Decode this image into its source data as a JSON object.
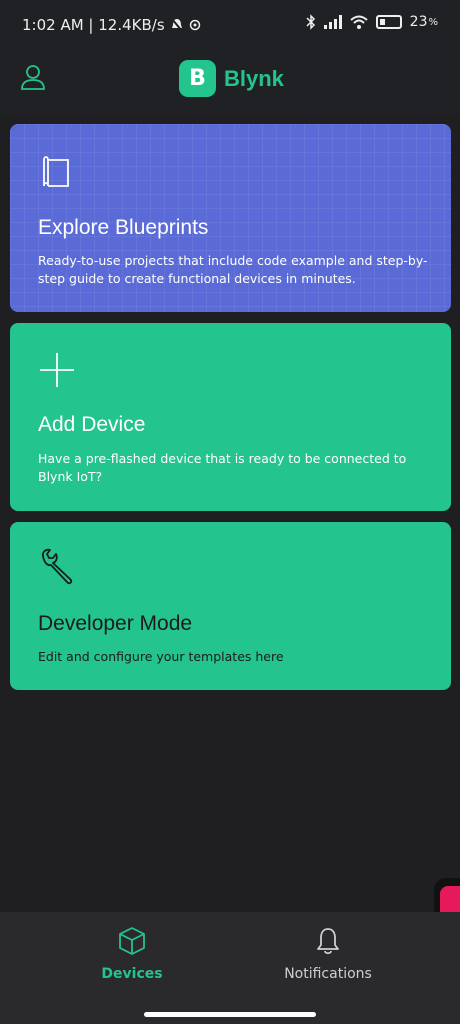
{
  "status_bar": {
    "time_speed": "1:02 AM | 12.4KB/s",
    "battery": "23"
  },
  "header": {
    "brand_letter": "B",
    "brand_name": "Blynk"
  },
  "cards": [
    {
      "title": "Explore Blueprints",
      "description": "Ready-to-use projects that include code example and step-by-step guide to create functional devices in minutes.",
      "icon": "book-icon"
    },
    {
      "title": "Add Device",
      "description": "Have a pre-flashed device that is ready to be connected to Blynk IoT?",
      "icon": "plus-icon"
    },
    {
      "title": "Developer Mode",
      "description": "Edit and configure your templates here",
      "icon": "wrench-icon"
    }
  ],
  "bottom_nav": {
    "items": [
      {
        "label": "Devices",
        "icon": "cube-icon",
        "active": true
      },
      {
        "label": "Notifications",
        "icon": "bell-icon",
        "active": false
      }
    ]
  },
  "colors": {
    "brand": "#23c48e",
    "blueprints_card": "#5a6bd8",
    "background": "#1f1f22"
  }
}
